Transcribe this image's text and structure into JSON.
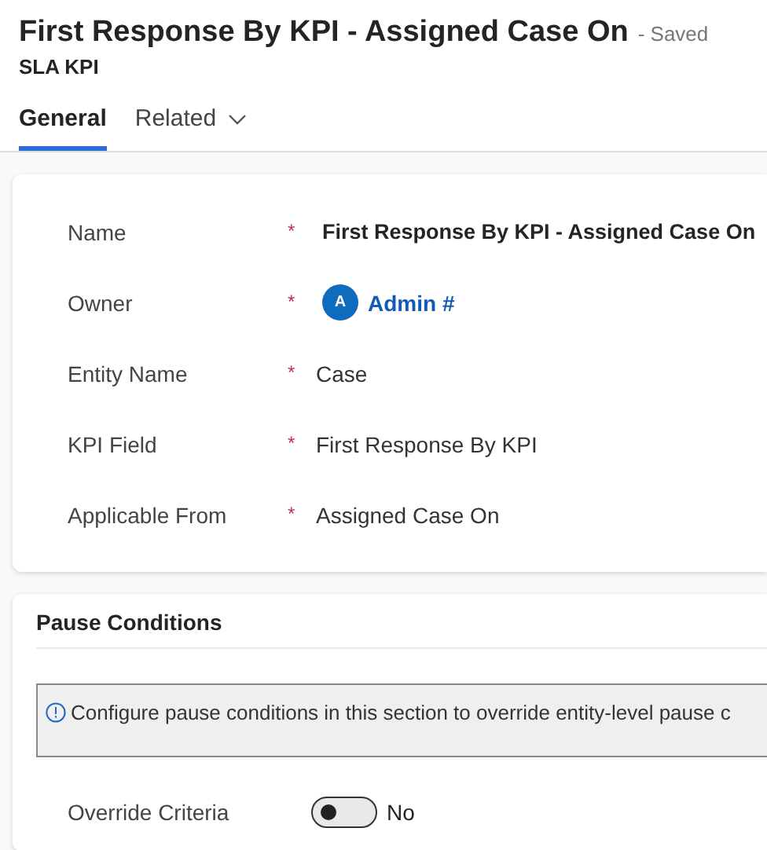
{
  "header": {
    "title": "First Response By KPI - Assigned Case On",
    "save_status": "- Saved",
    "entity": "SLA KPI"
  },
  "tabs": [
    {
      "label": "General",
      "selected": true,
      "dropdown": false
    },
    {
      "label": "Related",
      "selected": false,
      "dropdown": true
    }
  ],
  "fields": [
    {
      "label": "Name",
      "required_mark": "*",
      "kind": "strong",
      "value": "First Response By KPI - Assigned Case On"
    },
    {
      "label": "Owner",
      "required_mark": "*",
      "kind": "lookup",
      "avatar": "A",
      "value": "Admin #"
    },
    {
      "label": "Entity Name",
      "required_mark": "*",
      "kind": "text",
      "value": "Case"
    },
    {
      "label": "KPI Field",
      "required_mark": "*",
      "kind": "text",
      "value": "First Response By KPI"
    },
    {
      "label": "Applicable From",
      "required_mark": "*",
      "kind": "text",
      "value": "Assigned Case On"
    }
  ],
  "pause_section": {
    "title": "Pause Conditions",
    "info": "Configure pause conditions in this section to override entity-level pause c",
    "toggle": {
      "label": "Override Criteria",
      "on": false,
      "state_text": "No"
    }
  }
}
